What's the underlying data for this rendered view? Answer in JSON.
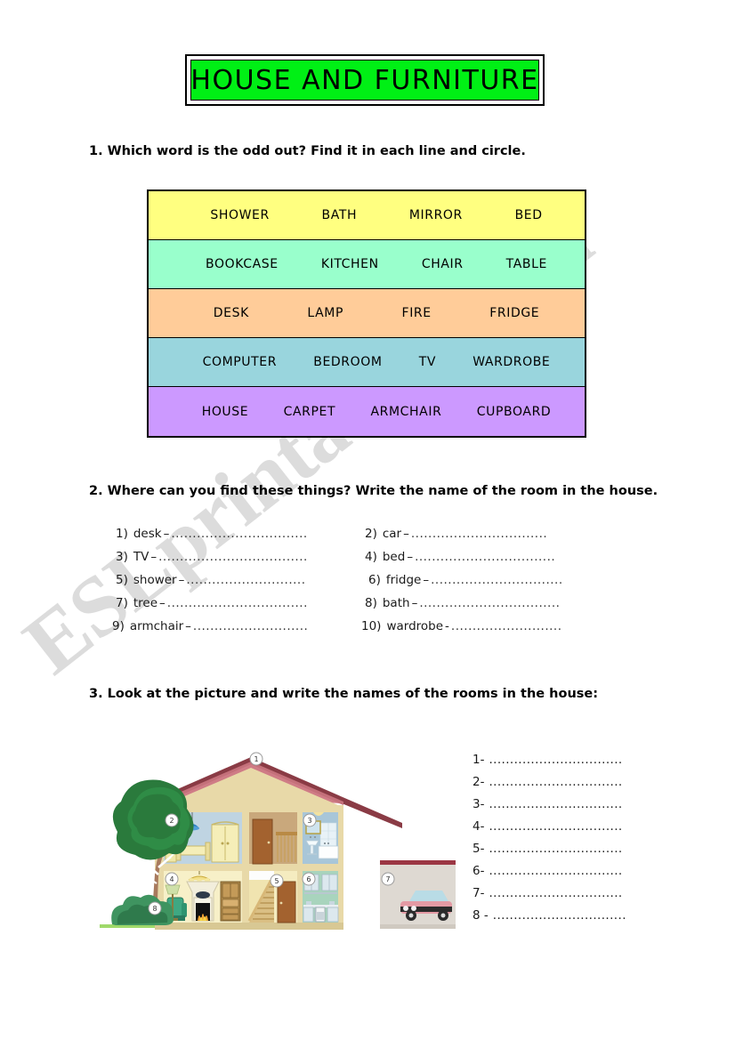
{
  "page": {
    "watermark": "ESLprintables.com",
    "background_color": "#ffffff"
  },
  "title": {
    "text": "HOUSE  AND FURNITURE",
    "background_color": "#00f015",
    "border_color": "#000000"
  },
  "exercise1": {
    "instruction": "1. Which word is the odd out? Find it in each line and circle.",
    "rows": [
      {
        "color": "#ffff80",
        "words": [
          "SHOWER",
          "BATH",
          "MIRROR",
          "BED"
        ]
      },
      {
        "color": "#99ffcc",
        "words": [
          "BOOKCASE",
          "KITCHEN",
          "CHAIR",
          "TABLE"
        ]
      },
      {
        "color": "#ffcc99",
        "words": [
          "DESK",
          "LAMP",
          "FIRE",
          "FRIDGE"
        ]
      },
      {
        "color": "#99d5dd",
        "words": [
          "COMPUTER",
          "BEDROOM",
          "TV",
          "WARDROBE"
        ]
      },
      {
        "color": "#cc99ff",
        "words": [
          "HOUSE",
          "CARPET",
          "ARMCHAIR",
          "CUPBOARD"
        ]
      }
    ]
  },
  "exercise2": {
    "instruction": "2.  Where can you find these things? Write the name of the room in the house.",
    "items": [
      {
        "number": "1)",
        "word": "desk",
        "dash": "–",
        "dots": "................................"
      },
      {
        "number": "2)",
        "word": "car",
        "dash": "–",
        "dots": " ................................"
      },
      {
        "number": "3)",
        "word": "TV",
        "dash": "–",
        "dots": " ..................................."
      },
      {
        "number": "4)",
        "word": "bed",
        "dash": "–",
        "dots": " ................................."
      },
      {
        "number": "5)",
        "word": "shower",
        "dash": "–",
        "dots": " ............................"
      },
      {
        "number": "6)",
        "word": "fridge",
        "dash": "–",
        "dots": "..............................."
      },
      {
        "number": "7)",
        "word": "tree",
        "dash": "–",
        "dots": "................................."
      },
      {
        "number": "8)",
        "word": "bath",
        "dash": "–",
        "dots": "................................."
      },
      {
        "number": "9)",
        "word": "armchair",
        "dash": "–",
        "dots": "..........................."
      },
      {
        "number": "10)",
        "word": "wardrobe",
        "dash": "-",
        "dots": ".........................."
      }
    ]
  },
  "exercise3": {
    "instruction": "3.  Look at the picture and write the names of the rooms in the house:",
    "answer_lines": [
      {
        "label": "1-",
        "dots": " ................................"
      },
      {
        "label": "2-",
        "dots": " ................................"
      },
      {
        "label": "3-",
        "dots": " ................................"
      },
      {
        "label": "4-",
        "dots": " ................................"
      },
      {
        "label": "5-",
        "dots": " ................................"
      },
      {
        "label": "6-",
        "dots": " ................................"
      },
      {
        "label": "7-",
        "dots": " ................................"
      },
      {
        "label": "8 -",
        "dots": " ................................"
      }
    ],
    "picture": {
      "description": "cut-away view of a two-storey house with a tree and garden on the left and a garage on the right",
      "markers": [
        {
          "id": "1",
          "target": "roof-attic"
        },
        {
          "id": "2",
          "target": "bedroom"
        },
        {
          "id": "3",
          "target": "bathroom"
        },
        {
          "id": "4",
          "target": "living-room"
        },
        {
          "id": "5",
          "target": "hall-stairs"
        },
        {
          "id": "6",
          "target": "kitchen"
        },
        {
          "id": "7",
          "target": "garage"
        },
        {
          "id": "8",
          "target": "garden"
        }
      ],
      "colors": {
        "roof": "#c4707a",
        "wall_frame": "#e8d9a8",
        "bedroom_wall": "#bfd4e2",
        "bathroom_wall": "#a8c6d8",
        "living_wall": "#f7f0c8",
        "hall_wall": "#f5ecc0",
        "kitchen_wall": "#a8d4bd",
        "garage_wall": "#ded9d2",
        "tree": "#2a7a3c",
        "bush": "#3f9460",
        "car_body": "#e49aa4",
        "grass": "#9fd96a"
      }
    }
  }
}
